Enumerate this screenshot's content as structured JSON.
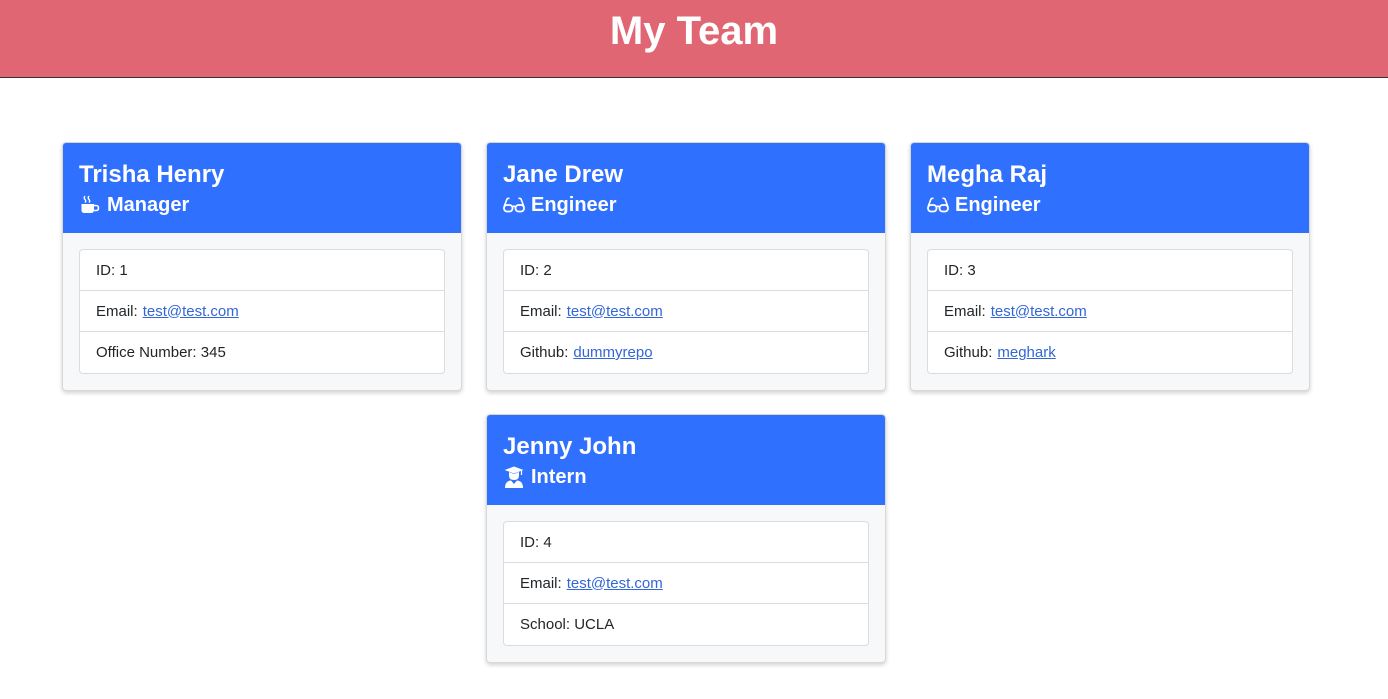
{
  "header": {
    "title": "My Team"
  },
  "colors": {
    "header_bg": "#e06673",
    "card_head_bg": "#3070ff",
    "link": "#3366d6"
  },
  "cards": [
    {
      "name": "Trisha Henry",
      "role": "Manager",
      "icon": "coffee-mug-icon",
      "id_label": "ID: 1",
      "email_label": "Email:",
      "email": "test@test.com",
      "extra_label": "Office Number: 345",
      "extra_link": ""
    },
    {
      "name": "Jane Drew",
      "role": "Engineer",
      "icon": "glasses-icon",
      "id_label": "ID: 2",
      "email_label": "Email:",
      "email": "test@test.com",
      "extra_label": "Github:",
      "extra_link": "dummyrepo"
    },
    {
      "name": "Megha Raj",
      "role": "Engineer",
      "icon": "glasses-icon",
      "id_label": "ID: 3",
      "email_label": "Email:",
      "email": "test@test.com",
      "extra_label": "Github:",
      "extra_link": "meghark"
    },
    {
      "name": "Jenny John",
      "role": "Intern",
      "icon": "graduate-icon",
      "id_label": "ID: 4",
      "email_label": "Email:",
      "email": "test@test.com",
      "extra_label": "School: UCLA",
      "extra_link": ""
    }
  ]
}
